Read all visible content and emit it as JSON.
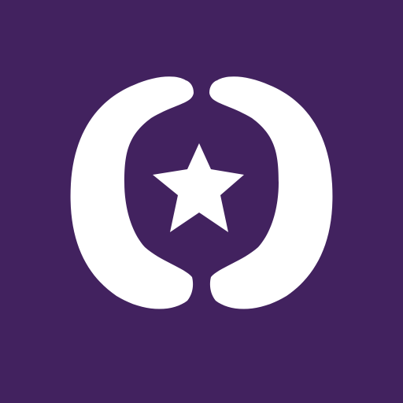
{
  "icon": {
    "name": "shield-star-app-icon",
    "background_color": "#42225f",
    "foreground_color": "#ffffff",
    "glyphs": [
      "left-bracket-shape",
      "right-bracket-shape",
      "star-icon"
    ]
  }
}
